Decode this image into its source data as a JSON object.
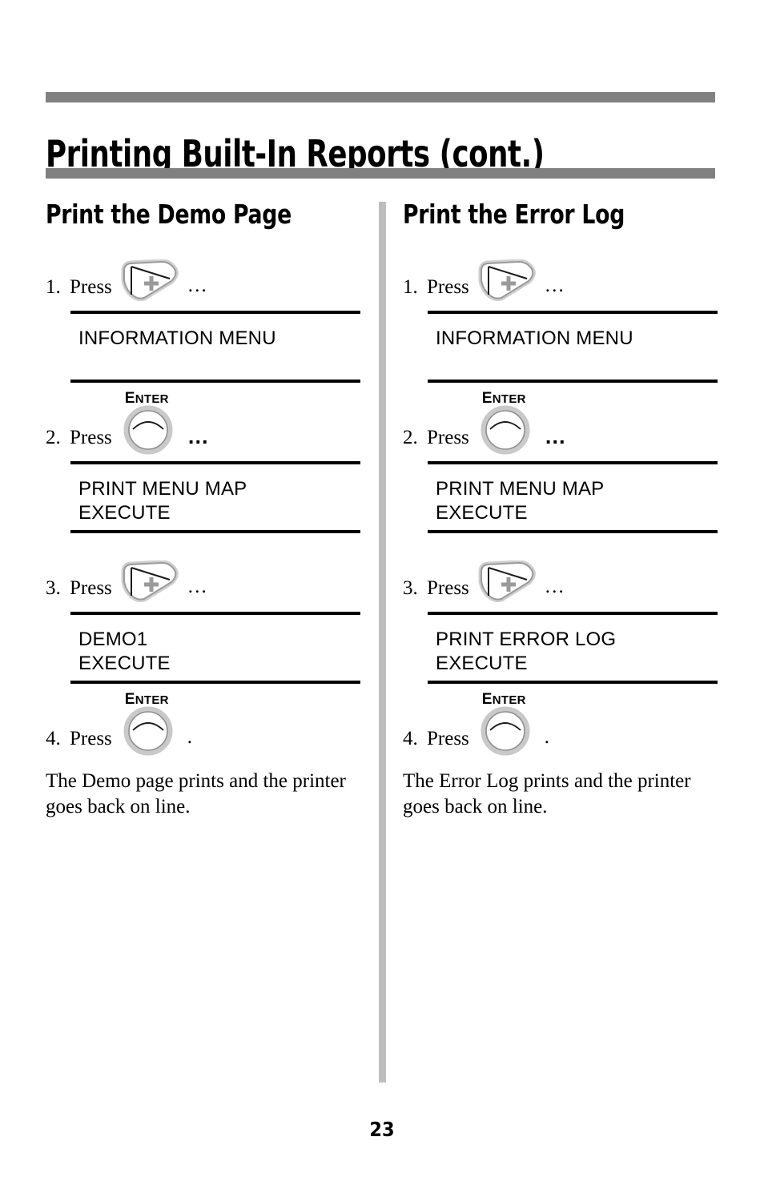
{
  "document": {
    "title": "Printing Built-In Reports (cont.)",
    "page_number": "23",
    "accent_bar_color": "#808080",
    "divider_color": "#bdbdbd"
  },
  "icons": {
    "plus_button": "plus-wedge-button-icon",
    "enter_button": "enter-round-button-icon",
    "enter_label_first": "E",
    "enter_label_rest": "NTER"
  },
  "columns": [
    {
      "heading": "Print the Demo Page",
      "steps": [
        {
          "number": "1.",
          "verb": "Press",
          "button": "plus",
          "trailer": "…",
          "trailer_style": "dots-thin",
          "display": [
            "INFORMATION MENU"
          ]
        },
        {
          "number": "2.",
          "verb": "Press",
          "button": "enter",
          "trailer": "…",
          "trailer_style": "dots-bold",
          "display": [
            "PRINT MENU MAP",
            "EXECUTE"
          ]
        },
        {
          "number": "3.",
          "verb": "Press",
          "button": "plus",
          "trailer": "…",
          "trailer_style": "dots-thin",
          "display": [
            "DEMO1",
            "EXECUTE"
          ]
        },
        {
          "number": "4.",
          "verb": "Press",
          "button": "enter",
          "trailer": ".",
          "trailer_style": "period",
          "display": []
        }
      ],
      "outro": "The Demo page prints and the printer goes back on line."
    },
    {
      "heading": "Print the Error Log",
      "steps": [
        {
          "number": "1.",
          "verb": "Press",
          "button": "plus",
          "trailer": "…",
          "trailer_style": "dots-thin",
          "display": [
            "INFORMATION MENU"
          ]
        },
        {
          "number": "2.",
          "verb": "Press",
          "button": "enter",
          "trailer": "…",
          "trailer_style": "dots-bold",
          "display": [
            "PRINT MENU MAP",
            "EXECUTE"
          ]
        },
        {
          "number": "3.",
          "verb": "Press",
          "button": "plus",
          "trailer": "…",
          "trailer_style": "dots-thin",
          "display": [
            "PRINT ERROR LOG",
            "EXECUTE"
          ]
        },
        {
          "number": "4.",
          "verb": "Press",
          "button": "enter",
          "trailer": ".",
          "trailer_style": "period",
          "display": []
        }
      ],
      "outro": "The Error Log prints and the printer goes back on line."
    }
  ]
}
